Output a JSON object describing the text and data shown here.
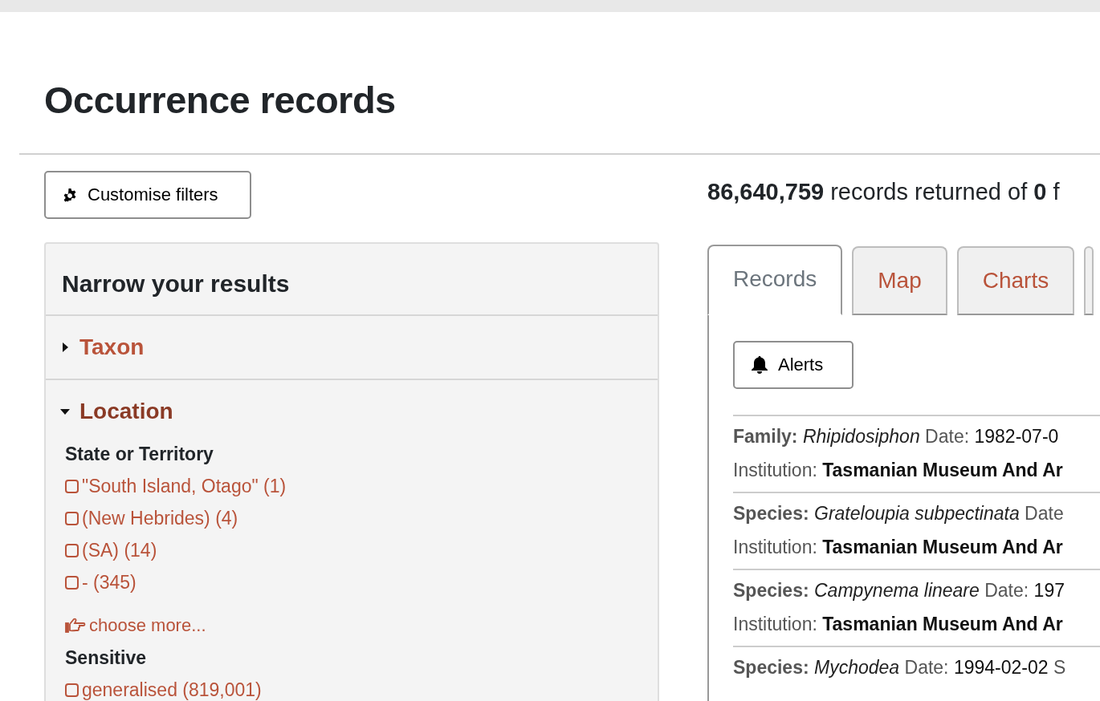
{
  "page": {
    "title": "Occurrence records"
  },
  "customise_button": {
    "label": "Customise filters"
  },
  "facets": {
    "title": "Narrow your results",
    "sections": [
      {
        "title": "Taxon",
        "expanded": false
      },
      {
        "title": "Location",
        "expanded": true,
        "groups": [
          {
            "title": "State or Territory",
            "items": [
              {
                "label": "\"South Island, Otago\" (1)",
                "checked": false
              },
              {
                "label": "(New Hebrides) (4)",
                "checked": false
              },
              {
                "label": "(SA) (14)",
                "checked": false
              },
              {
                "label": "- (345)",
                "checked": false
              }
            ],
            "more": "choose more..."
          },
          {
            "title": "Sensitive",
            "items": [
              {
                "label": "generalised (819,001)",
                "checked": false
              }
            ]
          }
        ]
      }
    ]
  },
  "summary": {
    "count": "86,640,759",
    "text": "records returned of",
    "total": "0",
    "tail": "f"
  },
  "tabs": [
    {
      "label": "Records",
      "selected": true
    },
    {
      "label": "Map",
      "selected": false
    },
    {
      "label": "Charts",
      "selected": false
    }
  ],
  "alerts_button": {
    "label": "Alerts"
  },
  "records": [
    {
      "rank": "Family:",
      "name": "Rhipidosiphon",
      "date_label": "Date:",
      "date": "1982-07-0",
      "institution_label": "Institution:",
      "institution": "Tasmanian Museum And Ar"
    },
    {
      "rank": "Species:",
      "name": "Grateloupia subpectinata",
      "date_label": "Date",
      "institution_label": "Institution:",
      "institution": "Tasmanian Museum And Ar"
    },
    {
      "rank": "Species:",
      "name": "Campynema lineare",
      "date_label": "Date:",
      "date": "197",
      "institution_label": "Institution:",
      "institution": "Tasmanian Museum And Ar"
    },
    {
      "rank": "Species:",
      "name": "Mychodea",
      "date_label": "Date:",
      "date": "1994-02-02",
      "extra": "S"
    }
  ]
}
